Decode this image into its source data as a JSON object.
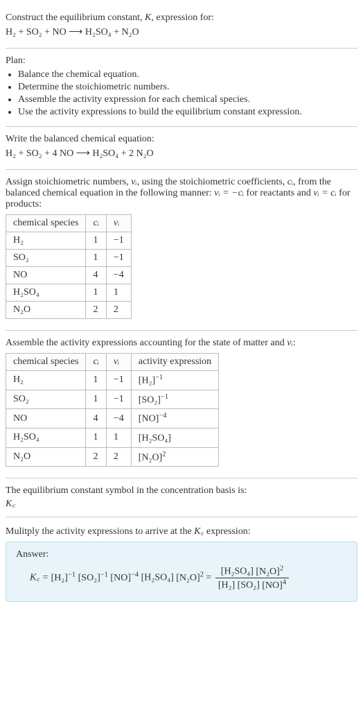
{
  "intro": {
    "line1_pre": "Construct the equilibrium constant, ",
    "line1_post": ", expression for:",
    "K": "K",
    "equation": "H₂ + SO₂ + NO ⟶ H₂SO₄ + N₂O"
  },
  "plan": {
    "title": "Plan:",
    "items": [
      "Balance the chemical equation.",
      "Determine the stoichiometric numbers.",
      "Assemble the activity expression for each chemical species.",
      "Use the activity expressions to build the equilibrium constant expression."
    ]
  },
  "balanced": {
    "title": "Write the balanced chemical equation:",
    "equation": "H₂ + SO₂ + 4 NO ⟶ H₂SO₄ + 2 N₂O"
  },
  "stoich": {
    "text_prefix": "Assign stoichiometric numbers, ",
    "nu_i": "νᵢ",
    "text_mid1": ", using the stoichiometric coefficients, ",
    "c_i": "cᵢ",
    "text_mid2": ", from the balanced chemical equation in the following manner: ",
    "rel1": "νᵢ = −cᵢ",
    "text_mid3": " for reactants and ",
    "rel2": "νᵢ = cᵢ",
    "text_end": " for products:",
    "headers": {
      "species": "chemical species",
      "c": "cᵢ",
      "nu": "νᵢ"
    },
    "rows": [
      {
        "species": "H₂",
        "c": "1",
        "nu": "−1"
      },
      {
        "species": "SO₂",
        "c": "1",
        "nu": "−1"
      },
      {
        "species": "NO",
        "c": "4",
        "nu": "−4"
      },
      {
        "species": "H₂SO₄",
        "c": "1",
        "nu": "1"
      },
      {
        "species": "N₂O",
        "c": "2",
        "nu": "2"
      }
    ]
  },
  "activity": {
    "title_pre": "Assemble the activity expressions accounting for the state of matter and ",
    "nu_i": "νᵢ",
    "title_post": ":",
    "headers": {
      "species": "chemical species",
      "c": "cᵢ",
      "nu": "νᵢ",
      "act": "activity expression"
    },
    "rows": [
      {
        "species": "H₂",
        "c": "1",
        "nu": "−1",
        "base": "[H₂]",
        "exp": "−1"
      },
      {
        "species": "SO₂",
        "c": "1",
        "nu": "−1",
        "base": "[SO₂]",
        "exp": "−1"
      },
      {
        "species": "NO",
        "c": "4",
        "nu": "−4",
        "base": "[NO]",
        "exp": "−4"
      },
      {
        "species": "H₂SO₄",
        "c": "1",
        "nu": "1",
        "base": "[H₂SO₄]",
        "exp": ""
      },
      {
        "species": "N₂O",
        "c": "2",
        "nu": "2",
        "base": "[N₂O]",
        "exp": "2"
      }
    ]
  },
  "symbol": {
    "title": "The equilibrium constant symbol in the concentration basis is:",
    "Kc": "K꜀"
  },
  "final": {
    "title_pre": "Mulitply the activity expressions to arrive at the ",
    "Kc": "K꜀",
    "title_post": " expression:",
    "answer_label": "Answer:",
    "lhs": "K꜀ = ",
    "prod_a": "[H₂]",
    "exp_a": "−1",
    "prod_b": "[SO₂]",
    "exp_b": "−1",
    "prod_c": "[NO]",
    "exp_c": "−4",
    "prod_d": "[H₂SO₄]",
    "prod_e": "[N₂O]",
    "exp_e": "2",
    "eq_sign": " = ",
    "num_a": "[H₂SO₄]",
    "num_b": "[N₂O]",
    "num_b_exp": "2",
    "den_a": "[H₂]",
    "den_b": "[SO₂]",
    "den_c": "[NO]",
    "den_c_exp": "4"
  },
  "chart_data": {
    "type": "table",
    "tables": [
      {
        "title": "Stoichiometric numbers",
        "columns": [
          "chemical species",
          "cᵢ",
          "νᵢ"
        ],
        "rows": [
          [
            "H₂",
            1,
            -1
          ],
          [
            "SO₂",
            1,
            -1
          ],
          [
            "NO",
            4,
            -4
          ],
          [
            "H₂SO₄",
            1,
            1
          ],
          [
            "N₂O",
            2,
            2
          ]
        ]
      },
      {
        "title": "Activity expressions",
        "columns": [
          "chemical species",
          "cᵢ",
          "νᵢ",
          "activity expression"
        ],
        "rows": [
          [
            "H₂",
            1,
            -1,
            "[H₂]^(−1)"
          ],
          [
            "SO₂",
            1,
            -1,
            "[SO₂]^(−1)"
          ],
          [
            "NO",
            4,
            -4,
            "[NO]^(−4)"
          ],
          [
            "H₂SO₄",
            1,
            1,
            "[H₂SO₄]"
          ],
          [
            "N₂O",
            2,
            2,
            "[N₂O]^2"
          ]
        ]
      }
    ]
  }
}
